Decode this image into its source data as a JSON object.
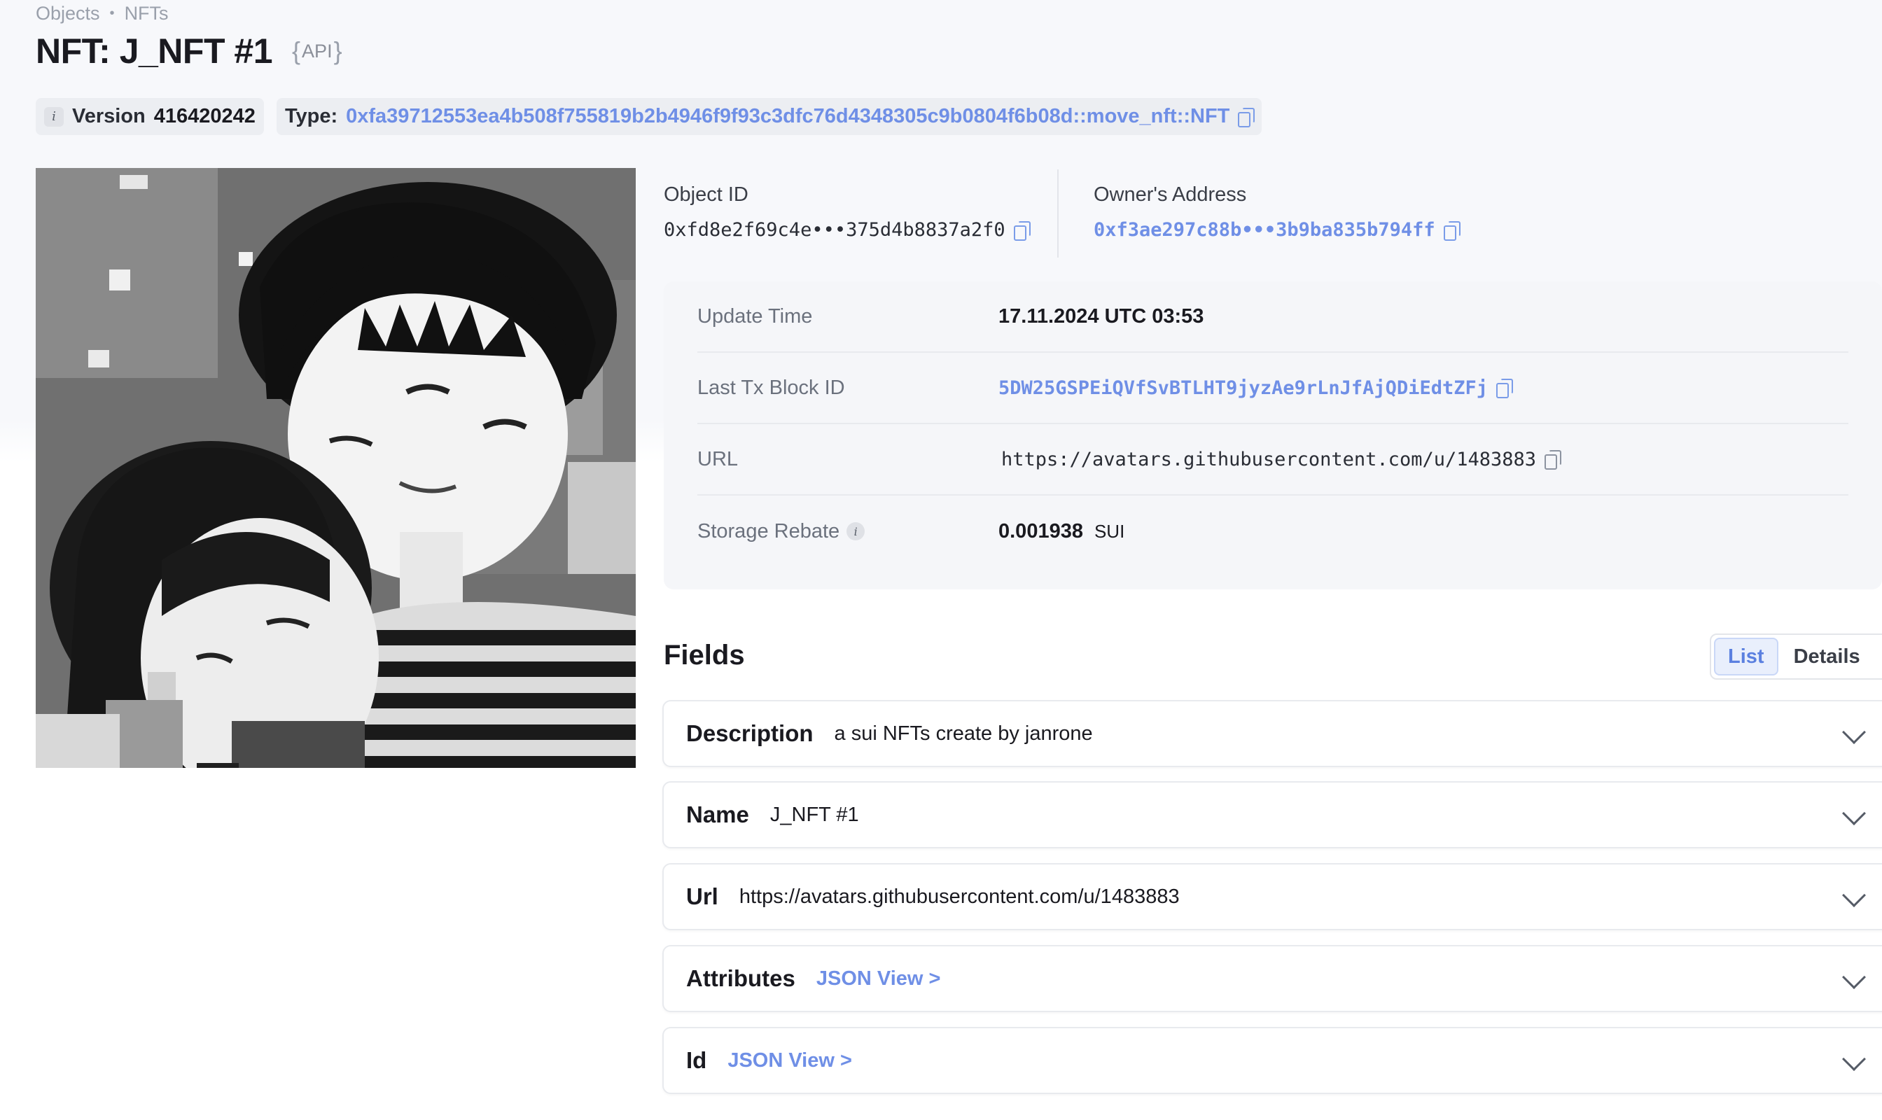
{
  "breadcrumb": {
    "parent": "Objects",
    "separator": "•",
    "current": "NFTs"
  },
  "header": {
    "title": "NFT: J_NFT #1",
    "api_label": "API",
    "brace_open": "{",
    "brace_close": "}"
  },
  "chips": {
    "version_label": "Version",
    "version_value": "416420242",
    "type_label": "Type:",
    "type_value": "0xfa39712553ea4b508f755819b2b4946f9f93c3dfc76d4348305c9b0804f6b08d::move_nft::NFT"
  },
  "object": {
    "id_label": "Object ID",
    "id_value": "0xfd8e2f69c4e•••375d4b8837a2f0",
    "owner_label": "Owner's Address",
    "owner_value": "0xf3ae297c88b•••3b9ba835b794ff"
  },
  "properties": [
    {
      "label": "Update Time",
      "value": "17.11.2024 UTC 03:53"
    },
    {
      "label": "Last Tx Block ID",
      "value": "5DW25GSPEiQVfSvBTLHT9jyzAe9rLnJfAjQDiEdtZFj"
    },
    {
      "label": "URL",
      "value": "https://avatars.githubusercontent.com/u/1483883"
    },
    {
      "label": "Storage Rebate",
      "value": "0.001938",
      "unit": "SUI"
    }
  ],
  "fields": {
    "title": "Fields",
    "view_options": [
      "List",
      "Details"
    ],
    "active_view": "List",
    "items": [
      {
        "name": "Description",
        "value": "a sui NFTs create by janrone"
      },
      {
        "name": "Name",
        "value": "J_NFT #1"
      },
      {
        "name": "Url",
        "value": "https://avatars.githubusercontent.com/u/1483883"
      },
      {
        "name": "Attributes",
        "link": "JSON View >"
      },
      {
        "name": "Id",
        "link": "JSON View >"
      }
    ]
  },
  "icons": [
    "info-icon",
    "copy-icon",
    "chevron-down-icon",
    "nft-image"
  ],
  "colors": {
    "link": "#6f8fe6",
    "accent_active": "#5b80e0"
  }
}
